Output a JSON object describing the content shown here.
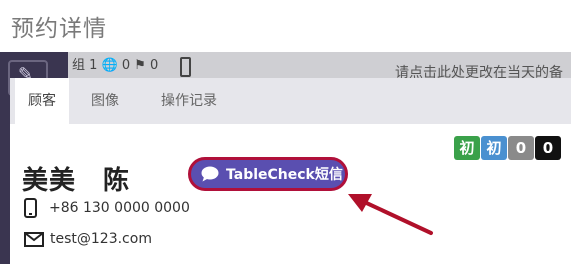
{
  "page": {
    "title": "预约详情"
  },
  "background": {
    "counts": "组 1 🌐 0 ⚑ 0",
    "note": "请点击此处更改在当天的备"
  },
  "tabs": [
    {
      "label": "顾客",
      "active": true
    },
    {
      "label": "图像",
      "active": false
    },
    {
      "label": "操作记录",
      "active": false
    }
  ],
  "customer": {
    "name": "美美　陈",
    "phone": "+86 130 0000 0000",
    "email": "test@123.com"
  },
  "sms_button": {
    "label": "TableCheck短信",
    "icon": "chat-bubble-icon",
    "color": "#5a4fb0",
    "border": "#b0103a"
  },
  "badges": [
    {
      "text": "初",
      "color": "#3aa14a"
    },
    {
      "text": "初",
      "color": "#4a90d0"
    },
    {
      "text": "0",
      "color": "#8a8a8a"
    },
    {
      "text": "0",
      "color": "#111111"
    }
  ],
  "annotation": {
    "icon": "red-arrow-icon",
    "color": "#b0102a"
  }
}
